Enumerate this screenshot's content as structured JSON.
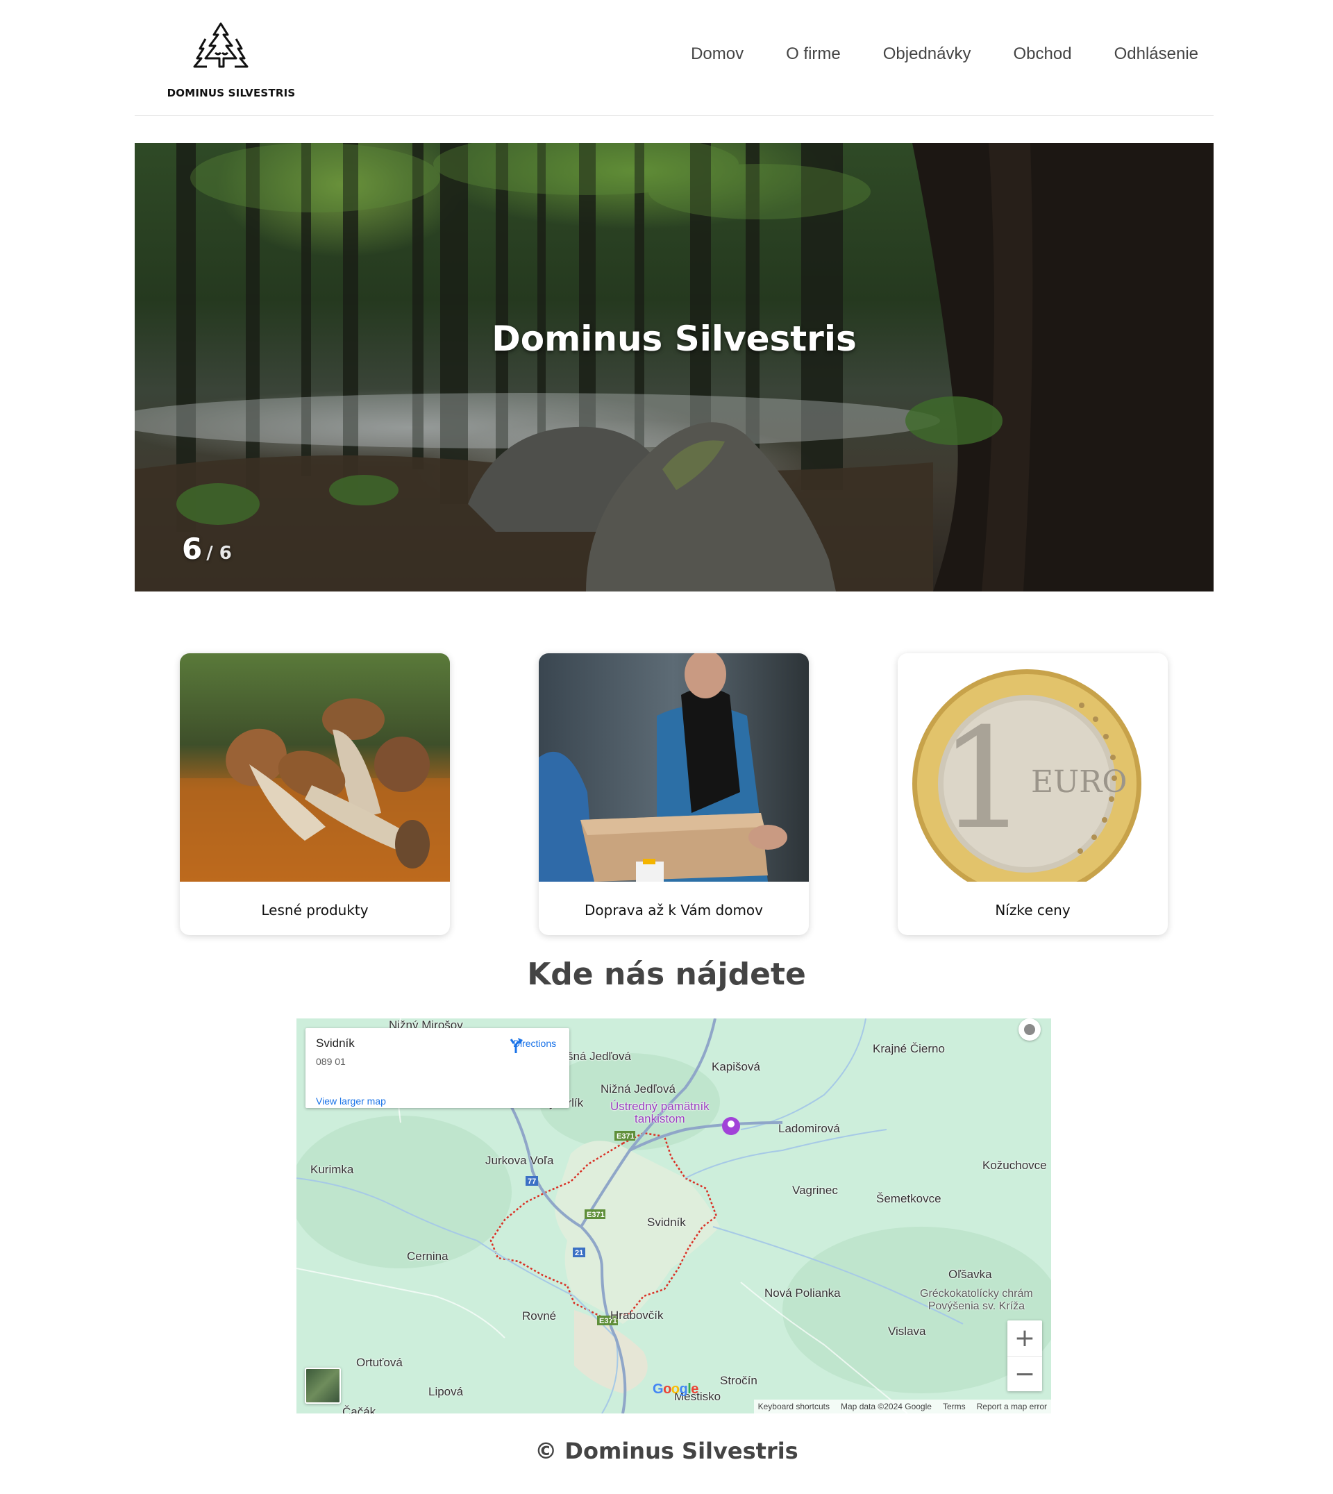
{
  "brand": {
    "logo_text": "DOMINUS SILVESTRIS",
    "logo_icon": "pine-trees-icon"
  },
  "nav": {
    "items": [
      "Domov",
      "O firme",
      "Objednávky",
      "Obchod",
      "Odhlásenie"
    ]
  },
  "hero": {
    "title": "Dominus Silvestris",
    "current_slide": "6",
    "total_slides": "/ 6"
  },
  "features": [
    {
      "caption": "Lesné produkty",
      "image": "porcini-mushrooms-photo"
    },
    {
      "caption": "Doprava až k Vám domov",
      "image": "parcel-delivery-photo"
    },
    {
      "caption": "Nízke ceny",
      "image": "one-euro-coin-photo"
    }
  ],
  "map_section": {
    "title": "Kde nás nájdete",
    "info": {
      "name": "Svidník",
      "zip": "089 01",
      "directions": "Directions",
      "larger_map": "View larger map"
    },
    "places": {
      "nizny_mirosov": "Nižný Mirošov",
      "vysna_jedlova": "šná Jedľová",
      "kapisova": "Kapišová",
      "krajne_cierno": "Krajné Čierno",
      "nizna_jedlova": "Nižná Jedľová",
      "nizny_orlik": "Nižný Orlík",
      "pamatnik": "Ústredný pamätník\ntankistom",
      "ladomirova": "Ladomirová",
      "jurkova_vola": "Jurkova Voľa",
      "kurimka": "Kurimka",
      "kozuchovce": "Kožuchovce",
      "vagrinec": "Vagrinec",
      "semetkovce": "Šemetkovce",
      "svidnik": "Svidník",
      "cernina": "Cernina",
      "olsavka": "Oľšavka",
      "church": "Gréckokatolícky chrám\nPovýšenia sv. Kríža",
      "nova_polianka": "Nová Polianka",
      "rovne": "Rovné",
      "hrabovcik": "Hrabovčík",
      "vislava": "Vislava",
      "ortutova": "Ortuťová",
      "lipova": "Lipová",
      "strocin": "Stročín",
      "mestisko": "Mestisko",
      "cacak": "Čačák"
    },
    "roads": [
      "77",
      "E371",
      "E371",
      "21",
      "E371"
    ],
    "zoom_in": "+",
    "zoom_out": "−",
    "google": "Google",
    "attribution": {
      "shortcuts": "Keyboard shortcuts",
      "data": "Map data ©2024 Google",
      "terms": "Terms",
      "report": "Report a map error"
    }
  },
  "footer": {
    "text": "© Dominus Silvestris"
  },
  "colors": {
    "nav_text": "#444444",
    "link_blue": "#1a73e8",
    "map_green": "#cdeedb",
    "boundary_red": "#d93025"
  }
}
